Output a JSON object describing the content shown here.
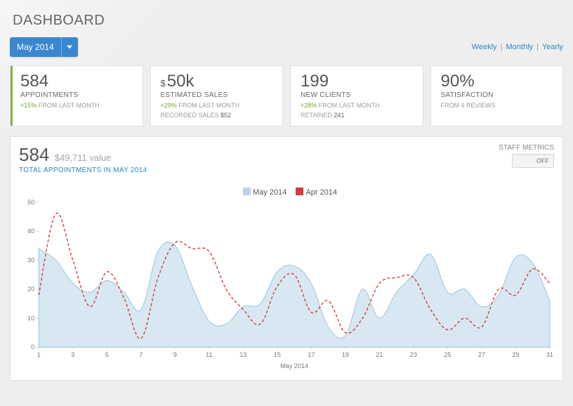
{
  "title": "DASHBOARD",
  "period_dropdown": {
    "label": "May 2014"
  },
  "range_links": {
    "weekly": "Weekly",
    "monthly": "Monthly",
    "yearly": "Yearly"
  },
  "cards": {
    "appointments": {
      "value": "584",
      "label": "APPOINTMENTS",
      "delta": "+15%",
      "delta_suffix": " FROM LAST MONTH"
    },
    "sales": {
      "prefix": "$",
      "value": "50k",
      "label": "ESTIMATED SALES",
      "delta": "+29%",
      "delta_suffix": " FROM LAST MONTH",
      "extra_label": "RECORDED SALES ",
      "extra_value": "$52"
    },
    "clients": {
      "value": "199",
      "label": "NEW CLIENTS",
      "delta": "+28%",
      "delta_suffix": " FROM LAST MONTH",
      "extra_label": "RETAINED ",
      "extra_value": "241"
    },
    "satisfaction": {
      "value": "90%",
      "label": "SATISFACTION",
      "sub": "FROM 4 REVIEWS"
    }
  },
  "panel": {
    "count": "584",
    "value_text": "$49,711 value",
    "caption": "TOTAL APPOINTMENTS IN MAY 2014",
    "staff_metrics_label": "STAFF METRICS",
    "staff_metrics_state": "OFF"
  },
  "legend": {
    "series_a": "May 2014",
    "series_b": "Apr 2014"
  },
  "chart_data": {
    "type": "area",
    "xlabel": "May 2014",
    "ylabel": "",
    "ylim": [
      0,
      50
    ],
    "x": [
      1,
      2,
      3,
      4,
      5,
      6,
      7,
      8,
      9,
      10,
      11,
      12,
      13,
      14,
      15,
      16,
      17,
      18,
      19,
      20,
      21,
      22,
      23,
      24,
      25,
      26,
      27,
      28,
      29,
      30,
      31
    ],
    "x_ticks": [
      1,
      3,
      5,
      7,
      9,
      11,
      13,
      15,
      17,
      19,
      21,
      23,
      25,
      27,
      29,
      31
    ],
    "y_ticks": [
      0,
      10,
      20,
      30,
      40,
      50
    ],
    "series": [
      {
        "name": "May 2014",
        "style": "area",
        "values": [
          34,
          30,
          22,
          19,
          23,
          19,
          13,
          33,
          35,
          21,
          9,
          8,
          14,
          15,
          26,
          28,
          22,
          7,
          4,
          20,
          10,
          19,
          25,
          32,
          19,
          20,
          14,
          18,
          31,
          29,
          16
        ]
      },
      {
        "name": "Apr 2014",
        "style": "line",
        "values": [
          18,
          46,
          30,
          14,
          26,
          17,
          3,
          24,
          36,
          34,
          33,
          20,
          13,
          8,
          21,
          25,
          12,
          16,
          5,
          10,
          22,
          24,
          24,
          13,
          6,
          10,
          7,
          20,
          18,
          27,
          22
        ]
      }
    ]
  }
}
